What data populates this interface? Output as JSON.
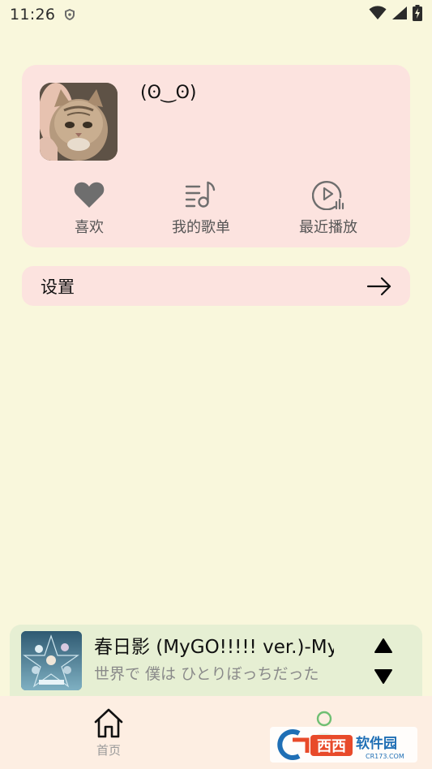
{
  "status_bar": {
    "time": "11:26",
    "icons": [
      "shield-icon",
      "wifi-icon",
      "signal-icon",
      "battery-charging-icon"
    ]
  },
  "profile": {
    "username": "(ʘ‿ʘ)",
    "avatar": "cat-photo",
    "actions": [
      {
        "label": "喜欢",
        "icon": "heart-icon"
      },
      {
        "label": "我的歌单",
        "icon": "playlist-icon"
      },
      {
        "label": "最近播放",
        "icon": "recent-play-icon"
      }
    ]
  },
  "settings": {
    "label": "设置",
    "icon": "arrow-right-icon"
  },
  "mini_player": {
    "title": "春日影 (MyGO!!!!! ver.)-MyGO!!!!!",
    "lyric": "世界で 僕は ひとりぼっちだった",
    "controls": [
      "triangle-up-icon",
      "triangle-down-icon"
    ]
  },
  "bottom_nav": {
    "home_label": "首页",
    "items": [
      "home-icon",
      "user-icon"
    ]
  },
  "watermark": {
    "text": "西西软件园",
    "sub": "CR173.COM"
  },
  "colors": {
    "background": "#f9f7dc",
    "card": "#fce3df",
    "player": "#e6efd3",
    "nav": "#fdeee2",
    "accent_green": "#6fbf73"
  }
}
